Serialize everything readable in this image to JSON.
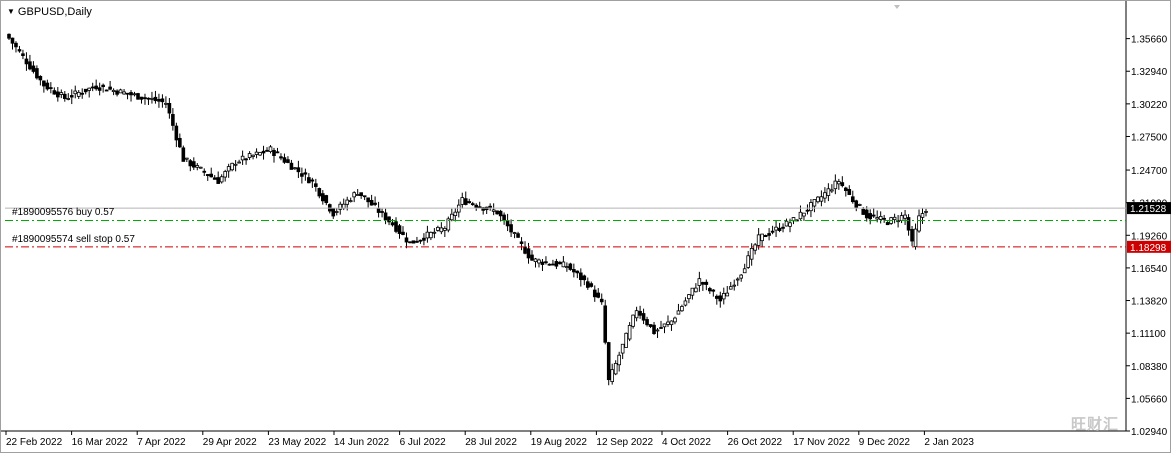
{
  "window": {
    "title": "GBPUSD,Daily",
    "menu_icon": "triangle-down-icon"
  },
  "orders": [
    {
      "label": "#1890095576 buy 0.57",
      "price": 1.20496,
      "line_color": "#00aa00",
      "style": "dash-dot"
    },
    {
      "label": "#1890095574 sell stop 0.57",
      "price": 1.18298,
      "line_color": "#cc0000",
      "style": "dash-dot"
    }
  ],
  "price_axis": {
    "ticks": [
      "1.35660",
      "1.32940",
      "1.30220",
      "1.27500",
      "1.24700",
      "1.21980",
      "1.19260",
      "1.16540",
      "1.13820",
      "1.11100",
      "1.08380",
      "1.05660",
      "1.02940"
    ],
    "current_price": {
      "label": "1.21528",
      "value": 1.21528,
      "bg": "#000000",
      "fg": "#ffffff"
    },
    "sell_stop_price": {
      "label": "1.18298",
      "value": 1.18298,
      "bg": "#cc0000",
      "fg": "#ffffff"
    }
  },
  "time_axis": {
    "labels": [
      "22 Feb 2022",
      "16 Mar 2022",
      "7 Apr 2022",
      "29 Apr 2022",
      "23 May 2022",
      "14 Jun 2022",
      "6 Jul 2022",
      "28 Jul 2022",
      "19 Aug 2022",
      "12 Sep 2022",
      "4 Oct 2022",
      "26 Oct 2022",
      "17 Nov 2022",
      "9 Dec 2022",
      "2 Jan 2023"
    ]
  },
  "watermark": "旺财汇",
  "chart_data": {
    "type": "candlestick",
    "symbol": "GBPUSD",
    "timeframe": "Daily",
    "ylim": [
      1.0294,
      1.3838
    ],
    "grid": false,
    "keyframes": [
      {
        "i": 0,
        "close": 1.357
      },
      {
        "i": 10,
        "close": 1.318
      },
      {
        "i": 16,
        "close": 1.307
      },
      {
        "i": 25,
        "close": 1.317
      },
      {
        "i": 45,
        "close": 1.303
      },
      {
        "i": 50,
        "close": 1.256
      },
      {
        "i": 60,
        "close": 1.238
      },
      {
        "i": 65,
        "close": 1.254
      },
      {
        "i": 75,
        "close": 1.264
      },
      {
        "i": 87,
        "close": 1.237
      },
      {
        "i": 93,
        "close": 1.211
      },
      {
        "i": 100,
        "close": 1.229
      },
      {
        "i": 110,
        "close": 1.202
      },
      {
        "i": 115,
        "close": 1.186
      },
      {
        "i": 125,
        "close": 1.199
      },
      {
        "i": 130,
        "close": 1.222
      },
      {
        "i": 140,
        "close": 1.212
      },
      {
        "i": 145,
        "close": 1.192
      },
      {
        "i": 150,
        "close": 1.172
      },
      {
        "i": 160,
        "close": 1.167
      },
      {
        "i": 166,
        "close": 1.152
      },
      {
        "i": 170,
        "close": 1.135
      },
      {
        "i": 172,
        "close": 1.071
      },
      {
        "i": 174,
        "close": 1.085
      },
      {
        "i": 180,
        "close": 1.131
      },
      {
        "i": 185,
        "close": 1.112
      },
      {
        "i": 190,
        "close": 1.121
      },
      {
        "i": 198,
        "close": 1.155
      },
      {
        "i": 204,
        "close": 1.138
      },
      {
        "i": 210,
        "close": 1.162
      },
      {
        "i": 215,
        "close": 1.19
      },
      {
        "i": 225,
        "close": 1.205
      },
      {
        "i": 232,
        "close": 1.222
      },
      {
        "i": 238,
        "close": 1.238
      },
      {
        "i": 242,
        "close": 1.222
      },
      {
        "i": 246,
        "close": 1.209
      },
      {
        "i": 252,
        "close": 1.204
      },
      {
        "i": 257,
        "close": 1.209
      },
      {
        "i": 259,
        "close": 1.185
      },
      {
        "i": 261,
        "close": 1.207
      },
      {
        "i": 263,
        "close": 1.215
      }
    ]
  }
}
